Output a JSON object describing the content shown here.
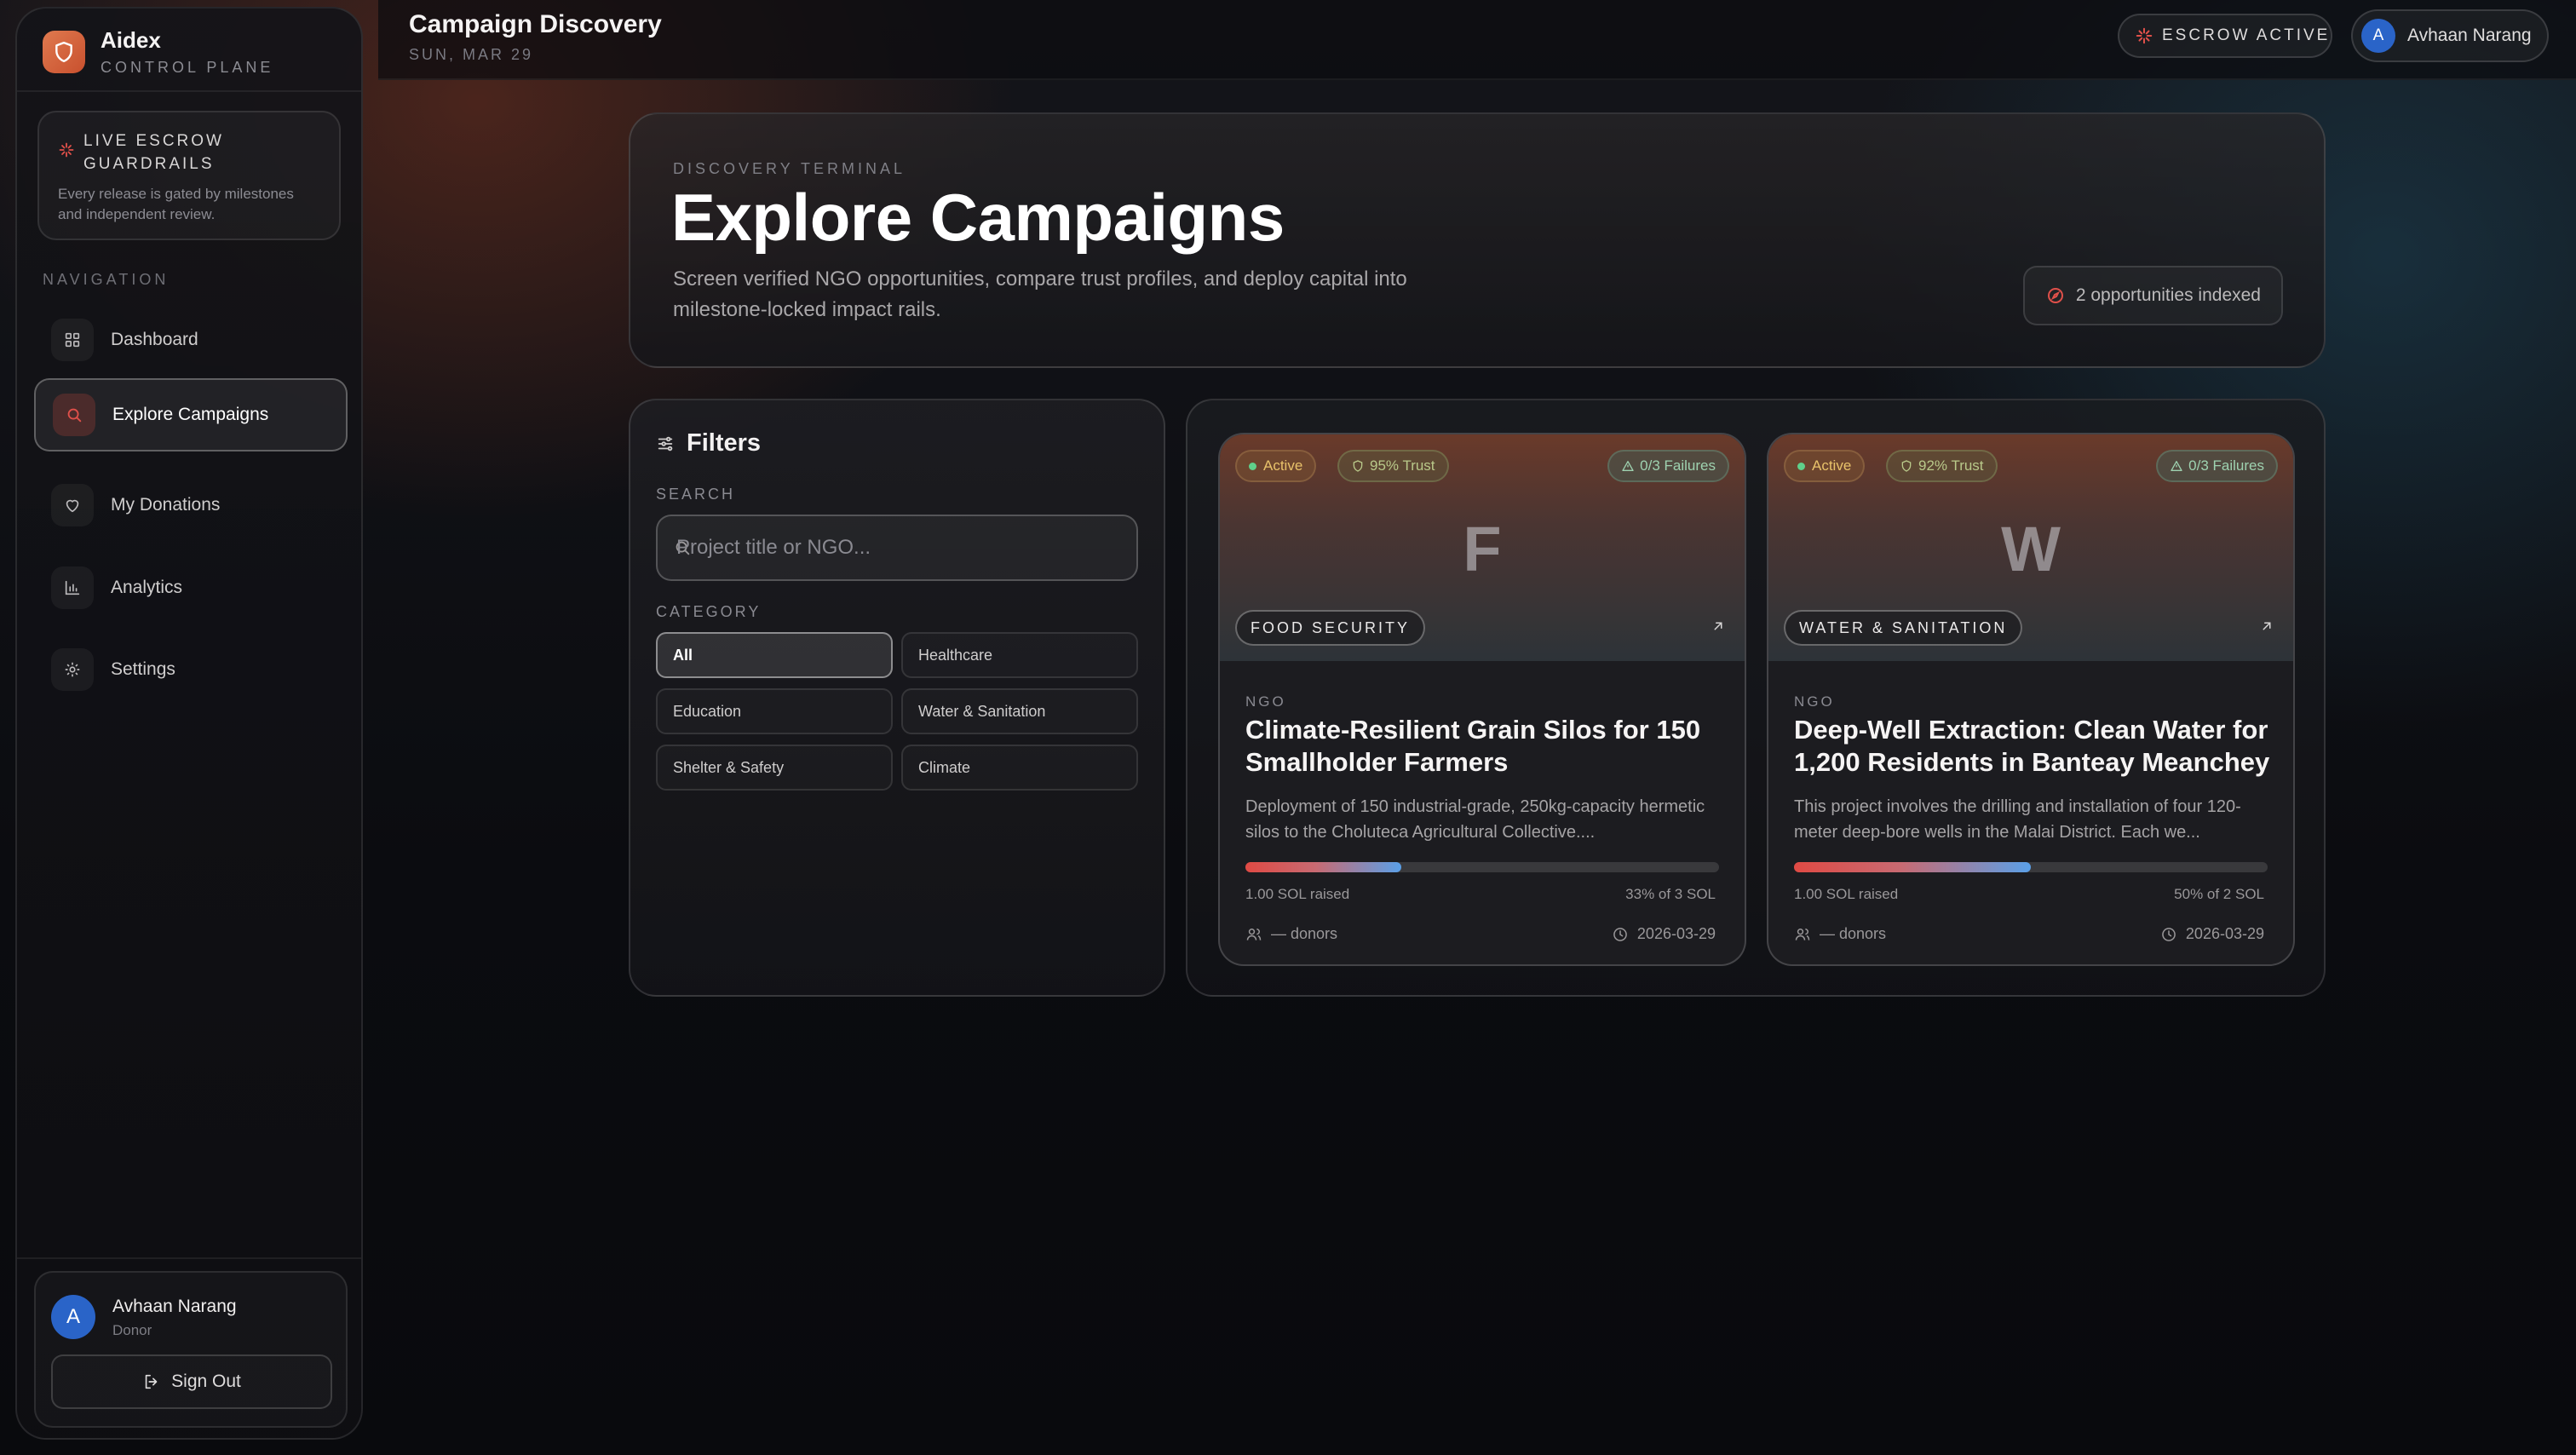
{
  "brand": {
    "name": "Aidex",
    "subtitle": "CONTROL PLANE"
  },
  "escrow_card": {
    "title": "LIVE ESCROW GUARDRAILS",
    "description": "Every release is gated by milestones and independent review."
  },
  "nav": {
    "heading": "NAVIGATION",
    "items": [
      {
        "label": "Dashboard",
        "icon": "grid-icon",
        "active": false
      },
      {
        "label": "Explore Campaigns",
        "icon": "search-icon",
        "active": true
      },
      {
        "label": "My Donations",
        "icon": "heart-icon",
        "active": false
      },
      {
        "label": "Analytics",
        "icon": "bar-chart-icon",
        "active": false
      },
      {
        "label": "Settings",
        "icon": "gear-icon",
        "active": false
      }
    ]
  },
  "user": {
    "initial": "A",
    "name": "Avhaan Narang",
    "role": "Donor",
    "signout_label": "Sign Out"
  },
  "topbar": {
    "title": "Campaign Discovery",
    "date": "SUN, MAR 29",
    "escrow_status": "ESCROW ACTIVE",
    "user_name": "Avhaan Narang",
    "user_initial": "A"
  },
  "hero": {
    "eyebrow": "DISCOVERY TERMINAL",
    "title": "Explore Campaigns",
    "description": "Screen verified NGO opportunities, compare trust profiles, and deploy capital into milestone-locked impact rails.",
    "count_label": "2 opportunities indexed"
  },
  "filters": {
    "title": "Filters",
    "search_label": "SEARCH",
    "search_placeholder": "Project title or NGO...",
    "search_value": "",
    "category_label": "CATEGORY",
    "categories": [
      {
        "label": "All",
        "selected": true
      },
      {
        "label": "Healthcare",
        "selected": false
      },
      {
        "label": "Education",
        "selected": false
      },
      {
        "label": "Water & Sanitation",
        "selected": false
      },
      {
        "label": "Shelter & Safety",
        "selected": false
      },
      {
        "label": "Climate",
        "selected": false
      }
    ]
  },
  "campaigns": [
    {
      "status": "Active",
      "trust": "95% Trust",
      "failures": "0/3 Failures",
      "letter": "F",
      "category": "FOOD SECURITY",
      "ngo_label": "NGO",
      "title": "Climate-Resilient Grain Silos for 150 Smallholder Farmers",
      "description": "Deployment of 150 industrial-grade, 250kg-capacity hermetic silos to the Choluteca Agricultural Collective....",
      "progress": 0.33,
      "raised": "1.00 SOL raised",
      "percent_label": "33% of 3 SOL",
      "donors": "— donors",
      "date": "2026-03-29"
    },
    {
      "status": "Active",
      "trust": "92% Trust",
      "failures": "0/3 Failures",
      "letter": "W",
      "category": "WATER & SANITATION",
      "ngo_label": "NGO",
      "title": "Deep-Well Extraction: Clean Water for 1,200 Residents in Banteay Meanchey",
      "description": "This project involves the drilling and installation of four 120-meter deep-bore wells in the Malai District. Each we...",
      "progress": 0.5,
      "raised": "1.00 SOL raised",
      "percent_label": "50% of 2 SOL",
      "donors": "— donors",
      "date": "2026-03-29"
    }
  ],
  "colors": {
    "accent": "#e04a44",
    "brand": "#d8633a",
    "avatar": "#2a64c8",
    "progress_end": "#5aa0e8"
  }
}
